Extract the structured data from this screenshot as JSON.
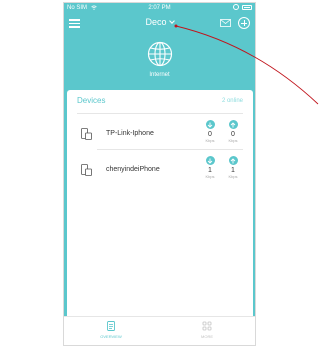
{
  "status_bar": {
    "carrier": "No SIM",
    "time": "2:07 PM"
  },
  "nav": {
    "title": "Deco"
  },
  "internet": {
    "label": "Internet"
  },
  "devices": {
    "title": "Devices",
    "online_count": "2 online",
    "items": [
      {
        "name": "TP-Link-Iphone",
        "down": "0",
        "down_unit": "Kbps",
        "up": "0",
        "up_unit": "Kbps"
      },
      {
        "name": "chenyindeiPhone",
        "down": "1",
        "down_unit": "Kbps",
        "up": "1",
        "up_unit": "Kbps"
      }
    ]
  },
  "tabs": [
    {
      "label": "OVERVIEW",
      "active": true
    },
    {
      "label": "MORE",
      "active": false
    }
  ],
  "colors": {
    "accent": "#5bc7cc",
    "annotation": "#c0141c"
  }
}
